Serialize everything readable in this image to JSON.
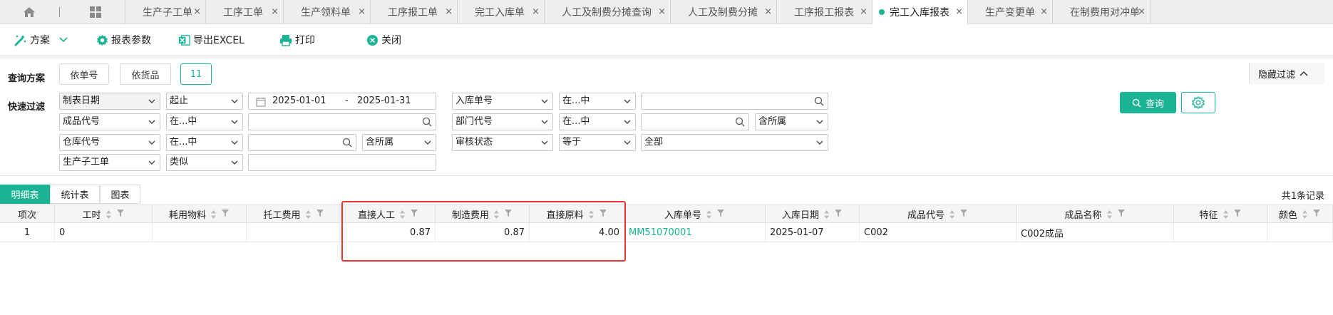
{
  "tabbar": {
    "tabs": [
      {
        "label": "生产子工单",
        "active": false
      },
      {
        "label": "工序工单",
        "active": false
      },
      {
        "label": "生产领料单",
        "active": false
      },
      {
        "label": "工序报工单",
        "active": false
      },
      {
        "label": "完工入库单",
        "active": false
      },
      {
        "label": "人工及制费分摊查询",
        "active": false
      },
      {
        "label": "人工及制费分摊",
        "active": false
      },
      {
        "label": "工序报工报表",
        "active": false
      },
      {
        "label": "完工入库报表",
        "active": true
      },
      {
        "label": "生产变更单",
        "active": false
      },
      {
        "label": "在制费用对冲单",
        "active": false
      }
    ],
    "close_glyph": "×"
  },
  "toolbar": {
    "scheme": "方案",
    "report_params": "报表参数",
    "export_excel": "导出EXCEL",
    "print": "打印",
    "close": "关闭"
  },
  "query": {
    "scheme_label": "查询方案",
    "by_order": "依单号",
    "by_goods": "依货品",
    "count_badge": "11",
    "quick_filter_label": "快速过滤",
    "hide_filter": "隐藏过滤",
    "query_button": "查询"
  },
  "filters": {
    "r1": {
      "field": "制表日期",
      "op": "起止",
      "date_from": "2025-01-01",
      "date_sep": "-",
      "date_to": "2025-01-31",
      "field2": "入库单号",
      "op2": "在...中",
      "value2": ""
    },
    "r2": {
      "field": "成品代号",
      "op": "在...中",
      "value": "",
      "field2": "部门代号",
      "op2": "在...中",
      "value2": "",
      "scope2": "含所属"
    },
    "r3": {
      "field": "仓库代号",
      "op": "在...中",
      "value": "",
      "scope": "含所属",
      "field2": "审核状态",
      "op2": "等于",
      "value2": "全部"
    },
    "r4": {
      "field": "生产子工单",
      "op": "类似",
      "value": ""
    }
  },
  "view_tabs": {
    "detail": "明细表",
    "stats": "统计表",
    "chart": "图表"
  },
  "record_count": "共1条记录",
  "table": {
    "headers": [
      "项次",
      "工时",
      "耗用物料",
      "托工费用",
      "直接人工",
      "制造费用",
      "直接原料",
      "入库单号",
      "入库日期",
      "成品代号",
      "成品名称",
      "特征",
      "颜色"
    ],
    "rows": [
      [
        "1",
        "0",
        "",
        "",
        "0.87",
        "0.87",
        "4.00",
        "MM51070001",
        "2025-01-07",
        "C002",
        "C002成品",
        "",
        ""
      ]
    ]
  },
  "colors": {
    "accent": "#1ab394",
    "highlight_box": "#e53935"
  }
}
